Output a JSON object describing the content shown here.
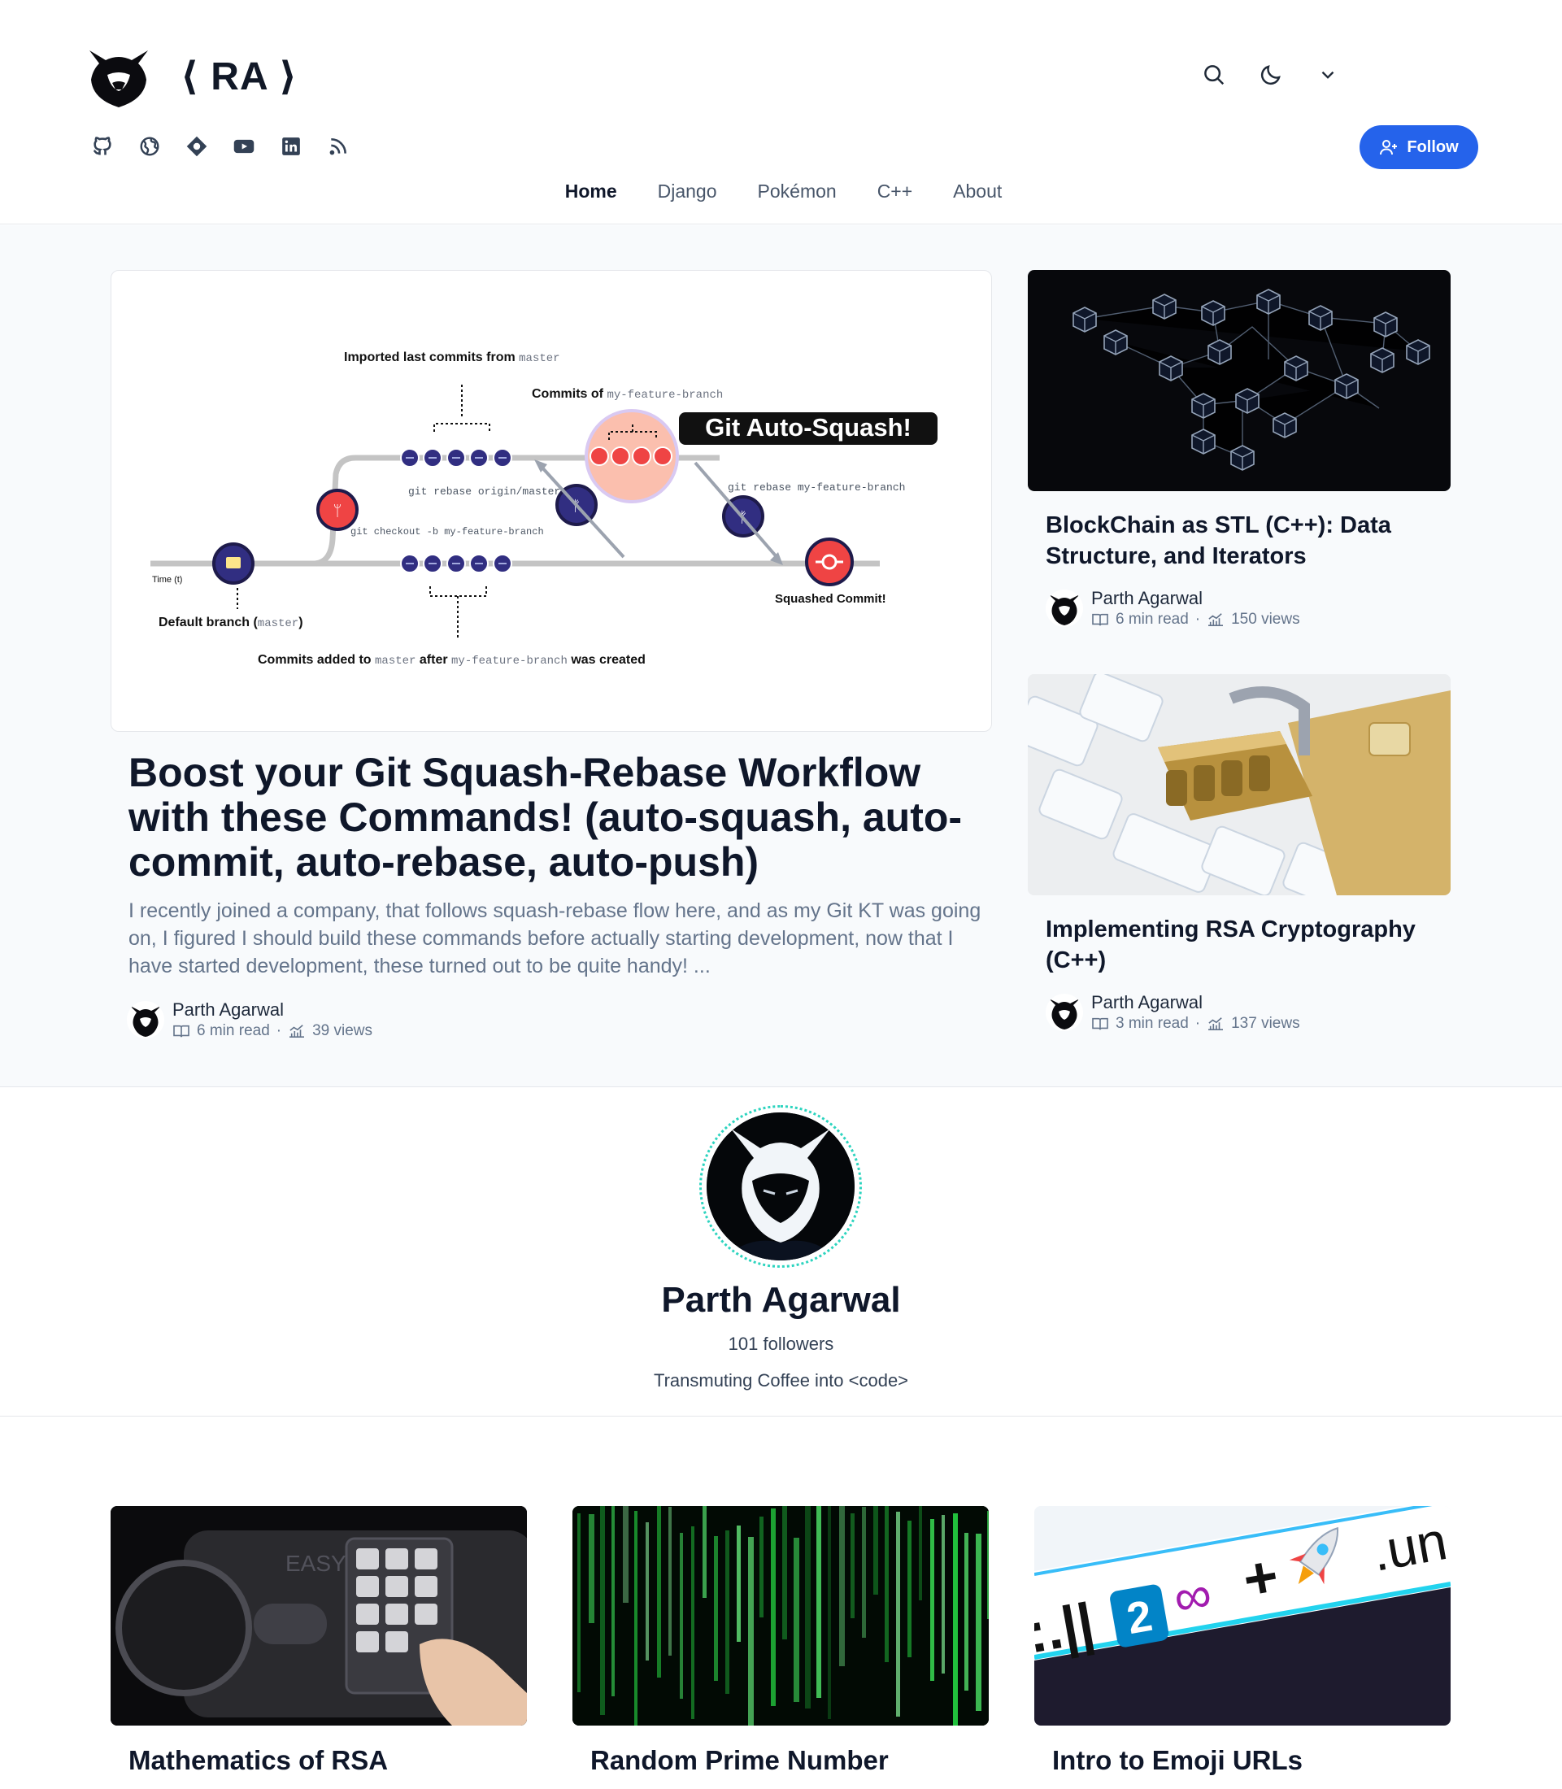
{
  "brand": {
    "text": "⟨ RA ⟩"
  },
  "social": [
    {
      "icon": "github-icon"
    },
    {
      "icon": "globe-icon"
    },
    {
      "icon": "hashnode-icon"
    },
    {
      "icon": "youtube-icon"
    },
    {
      "icon": "linkedin-icon"
    },
    {
      "icon": "rss-icon"
    }
  ],
  "header_tools": [
    "search-icon",
    "moon-icon",
    "chevron-down-icon"
  ],
  "follow_button": {
    "label": "Follow"
  },
  "nav": [
    {
      "label": "Home",
      "active": true
    },
    {
      "label": "Django"
    },
    {
      "label": "Pokémon"
    },
    {
      "label": "C++"
    },
    {
      "label": "About"
    }
  ],
  "diagram": {
    "label_imported": "Imported last commits from",
    "label_imported_code": "master",
    "label_commits_of": "Commits of",
    "label_commits_of_code": "my-feature-branch",
    "banner": "Git Auto-Squash!",
    "cmd_rebase_origin": "git rebase origin/master",
    "cmd_checkout": "git checkout -b my-feature-branch",
    "cmd_rebase_feature": "git rebase my-feature-branch",
    "label_time": "Time (t)",
    "label_default_branch": "Default branch (",
    "label_default_branch_code": "master",
    "label_default_branch_end": ")",
    "label_squashed": "Squashed Commit!",
    "label_added_1": "Commits added to",
    "label_added_code_1": "master",
    "label_added_2": "after",
    "label_added_code_2": "my-feature-branch",
    "label_added_3": "was created"
  },
  "featured": {
    "title": "Boost your Git Squash-Rebase Workflow with these Commands! (auto-squash, auto-commit, auto-rebase, auto-push)",
    "excerpt": "I recently joined a company, that follows squash-rebase flow here, and as my Git KT was going on, I figured I should build these commands before actually starting development, now that I have started development, these turned out to be quite handy! ...",
    "author": "Parth Agarwal",
    "read_time": "6 min read",
    "views": "39 views"
  },
  "side_posts": [
    {
      "title": "BlockChain as STL (C++): Data Structure, and Iterators",
      "author": "Parth Agarwal",
      "read_time": "6 min read",
      "views": "150 views"
    },
    {
      "title": "Implementing RSA Cryptography (C++)",
      "author": "Parth Agarwal",
      "read_time": "3 min read",
      "views": "137 views"
    }
  ],
  "author_section": {
    "name": "Parth Agarwal",
    "followers": "101 followers",
    "bio": "Transmuting Coffee into <code>"
  },
  "grid_posts": [
    {
      "title": "Mathematics of RSA",
      "image_text": "EASY HOME"
    },
    {
      "title": "Random Prime Number"
    },
    {
      "title": "Intro to Emoji URLs",
      "image_text_left": ":.||",
      "image_text_badge": "2",
      "image_text_right": ".un"
    }
  ],
  "meta_separator": "·",
  "colors": {
    "accent": "#2563eb",
    "ring": "#2dd4bf",
    "commit_red": "#ef4444",
    "commit_navy": "#312e81"
  }
}
